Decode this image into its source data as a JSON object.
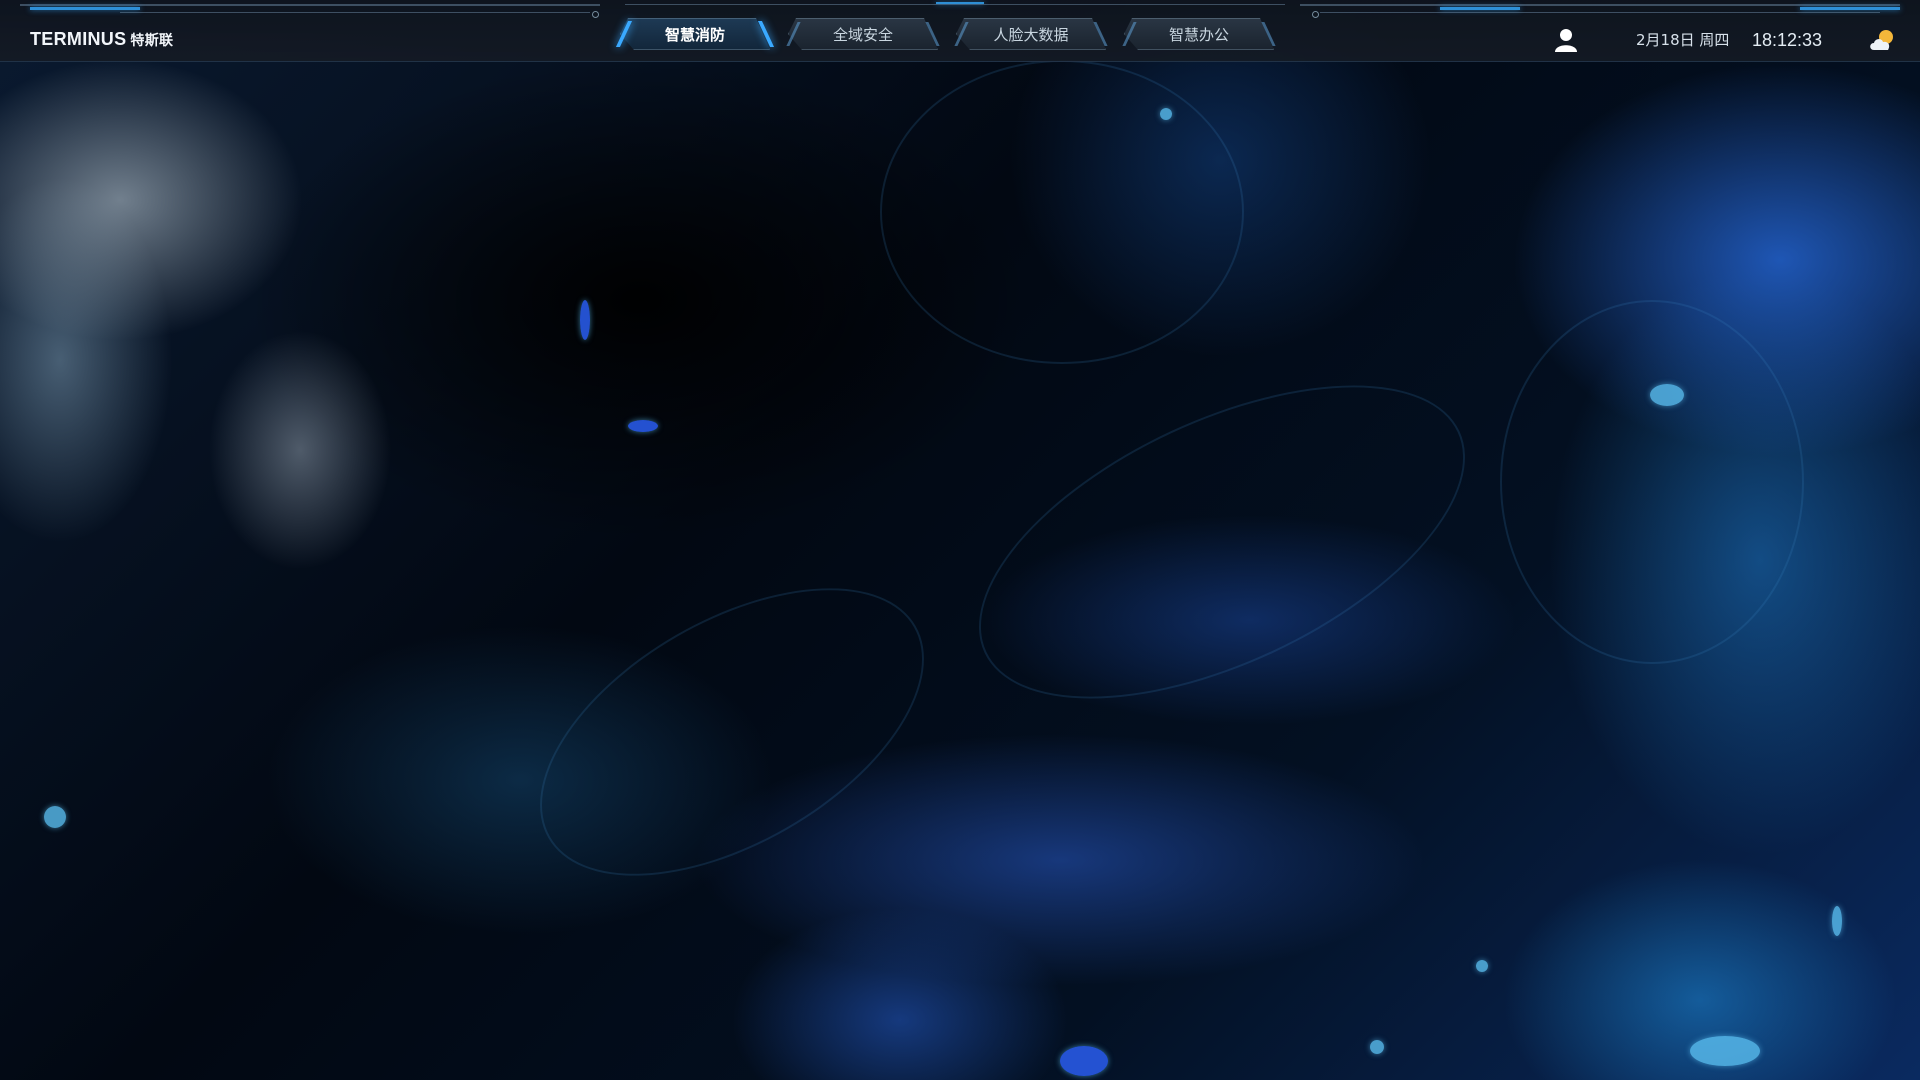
{
  "brand": {
    "name": "TERMINUS",
    "name_cn": "特斯联"
  },
  "nav": {
    "tabs": [
      {
        "label": "智慧消防",
        "active": true
      },
      {
        "label": "全域安全",
        "active": false
      },
      {
        "label": "人脸大数据",
        "active": false
      },
      {
        "label": "智慧办公",
        "active": false
      }
    ]
  },
  "status": {
    "date": "2月18日 周四",
    "time": "18:12:33",
    "user_icon": "user-icon",
    "weather_icon": "partly-cloudy-icon"
  },
  "colors": {
    "accent": "#3aa9ff",
    "header_bg": "#141a24",
    "background": "#02060f"
  }
}
